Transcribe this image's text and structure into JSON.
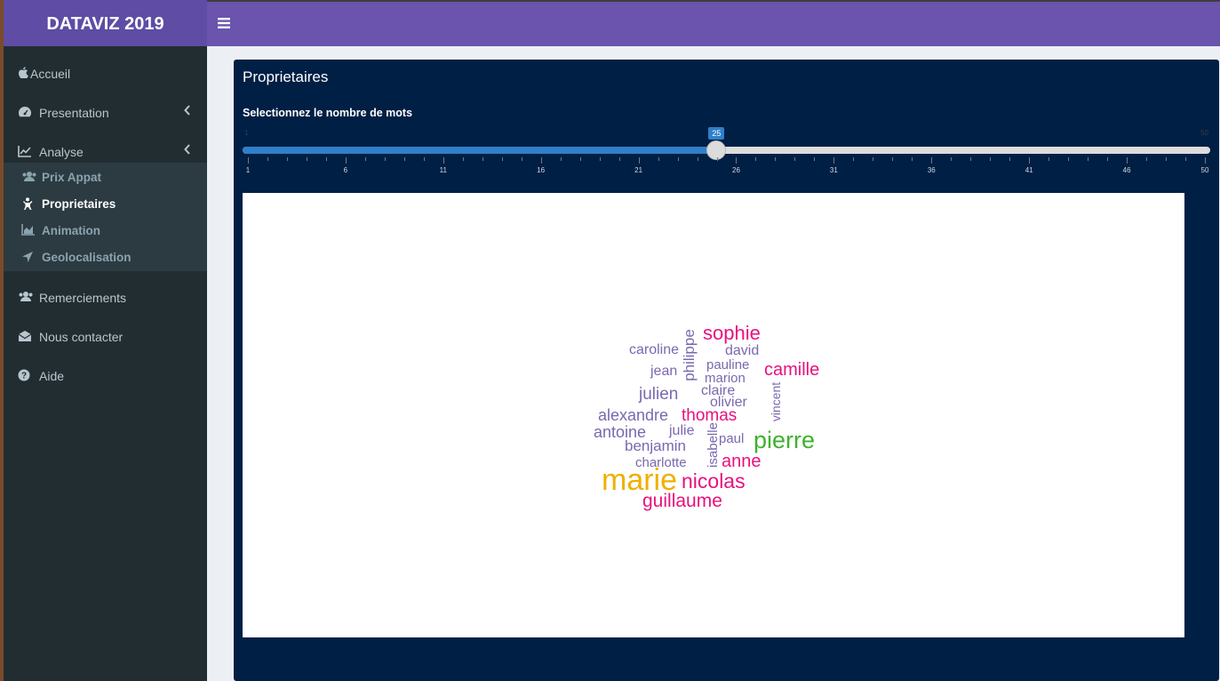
{
  "app": {
    "title": "DATAVIZ 2019"
  },
  "colors": {
    "header": "#6a54ad",
    "logo": "#5e4ca5",
    "sidebar": "#222d32",
    "content": "#001f44",
    "slider": "#2f7fc9"
  },
  "sidebar": {
    "items": [
      {
        "label": "Accueil",
        "icon": "apple-icon"
      },
      {
        "label": "Presentation",
        "icon": "dashboard-icon"
      },
      {
        "label": "Analyse",
        "icon": "line-chart-icon"
      },
      {
        "label": "Remerciements",
        "icon": "users-icon"
      },
      {
        "label": "Nous contacter",
        "icon": "envelope-icon"
      },
      {
        "label": "Aide",
        "icon": "question-circle-icon"
      }
    ],
    "subitems": [
      {
        "label": "Prix Appat",
        "icon": "users-icon"
      },
      {
        "label": "Proprietaires",
        "icon": "child-icon"
      },
      {
        "label": "Animation",
        "icon": "area-chart-icon"
      },
      {
        "label": "Geolocalisation",
        "icon": "location-arrow-icon"
      }
    ]
  },
  "box": {
    "title": "Proprietaires"
  },
  "slider": {
    "label": "Selectionnez le nombre de mots",
    "min": 1,
    "max": 50,
    "value": 25,
    "min_label": "1",
    "max_label": "50",
    "value_label": "25",
    "ticks": [
      "1",
      "6",
      "11",
      "16",
      "21",
      "26",
      "31",
      "36",
      "41",
      "46",
      "50"
    ]
  },
  "wordcloud": {
    "words": [
      {
        "text": "sophie",
        "color": "#e8107e"
      },
      {
        "text": "caroline",
        "color": "#7a68b0"
      },
      {
        "text": "david",
        "color": "#7a68b0"
      },
      {
        "text": "philippe",
        "color": "#7a68b0"
      },
      {
        "text": "jean",
        "color": "#7a68b0"
      },
      {
        "text": "pauline",
        "color": "#7a68b0"
      },
      {
        "text": "camille",
        "color": "#e8107e"
      },
      {
        "text": "marion",
        "color": "#7a68b0"
      },
      {
        "text": "julien",
        "color": "#7a68b0"
      },
      {
        "text": "claire",
        "color": "#7a68b0"
      },
      {
        "text": "vincent",
        "color": "#7a68b0"
      },
      {
        "text": "olivier",
        "color": "#7a68b0"
      },
      {
        "text": "alexandre",
        "color": "#7a68b0"
      },
      {
        "text": "thomas",
        "color": "#e8107e"
      },
      {
        "text": "antoine",
        "color": "#7a68b0"
      },
      {
        "text": "julie",
        "color": "#7a68b0"
      },
      {
        "text": "isabelle",
        "color": "#7a68b0"
      },
      {
        "text": "paul",
        "color": "#7a68b0"
      },
      {
        "text": "pierre",
        "color": "#3db22c"
      },
      {
        "text": "benjamin",
        "color": "#7a68b0"
      },
      {
        "text": "anne",
        "color": "#e8107e"
      },
      {
        "text": "charlotte",
        "color": "#7a68b0"
      },
      {
        "text": "marie",
        "color": "#f0b000"
      },
      {
        "text": "nicolas",
        "color": "#e8107e"
      },
      {
        "text": "guillaume",
        "color": "#e8107e"
      }
    ]
  }
}
